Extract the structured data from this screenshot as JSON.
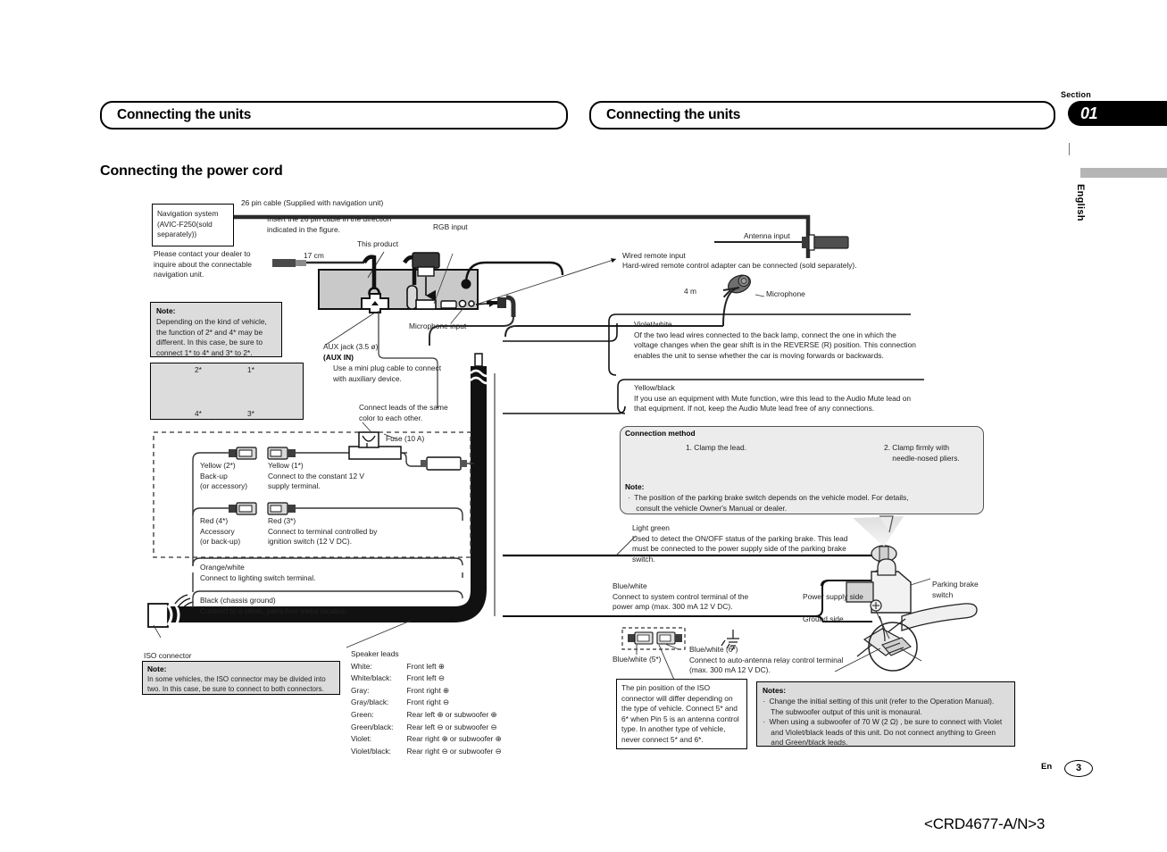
{
  "header": {
    "left_title": "Connecting the units",
    "right_title": "Connecting the units",
    "section_label": "Section",
    "section_number": "01",
    "language": "English"
  },
  "page_title": "Connecting the power cord",
  "diagram": {
    "nav_box": "Navigation system\n(AVIC-F250(sold\nseparately))",
    "nav_dealer_note": "Please contact your dealer to\ninquire about the connectable\nnavigation unit.",
    "cable_26pin": "26 pin cable (Supplied with navigation unit)",
    "insert_note": "Insert the 26 pin cable in the direction\nindicated in the figure.",
    "this_product": "This product",
    "rgb_input": "RGB input",
    "length_17cm": "17 cm",
    "microphone_input": "Microphone input",
    "antenna_input": "Antenna input",
    "wired_remote_title": "Wired remote input",
    "wired_remote_body": "Hard-wired remote control adapter can be connected (sold separately).",
    "mic_length": "4 m",
    "microphone": "Microphone",
    "note1_title": "Note:",
    "note1_body": "Depending on the kind of vehicle,\nthe function of 2* and 4* may be\ndifferent. In this case, be sure to\nconnect 1* to 4* and 3* to 2*.",
    "swap_labels": {
      "tl": "2*",
      "tr": "1*",
      "bl": "4*",
      "br": "3*"
    },
    "aux_jack_line1": "AUX jack (3.5 ø)",
    "aux_jack_line2": "(AUX IN)",
    "aux_jack_line3": "Use a mini plug cable to connect\nwith auxiliary device.",
    "same_color": "Connect leads of the same\ncolor to each other.",
    "fuse": "Fuse (10 A)",
    "yellow2_label": "Yellow (2*)\nBack-up\n(or accessory)",
    "yellow1_label": "Yellow (1*)\nConnect to the constant 12 V\nsupply terminal.",
    "red4_label": "Red (4*)\nAccessory\n(or back-up)",
    "red3_label": "Red (3*)\nConnect to terminal controlled by\nignition switch (12 V DC).",
    "orange_white": "Orange/white\nConnect to lighting switch terminal.",
    "black_ground": "Black (chassis ground)\nConnect to a clean, paint-free metal location.",
    "iso_connector": "ISO connector",
    "iso_note_title": "Note:",
    "iso_note_body": "In some vehicles, the ISO connector may be divided into\ntwo. In this case, be sure to connect to both connectors.",
    "violet_white": "Violet/white\nOf the two lead wires connected to the back lamp, connect the one in which the\nvoltage changes when the gear shift is in the REVERSE (R) position. This connection\nenables the unit to sense whether the car is moving forwards or backwards.",
    "yellow_black": "Yellow/black\nIf you use an equipment with Mute function, wire this lead to the Audio Mute lead on\nthat equipment. If not, keep the Audio Mute lead free of any connections.",
    "connection_method_title": "Connection method",
    "connection_step1": "1. Clamp the lead.",
    "connection_step2": "2. Clamp firmly with\n    needle-nosed pliers.",
    "connection_note_title": "Note:",
    "connection_note_body": "·  The position of the parking brake switch depends on the vehicle model. For details,\n    consult the vehicle Owner's Manual or dealer.",
    "light_green": "Light green\nUsed to detect the ON/OFF status of the parking brake. This lead\nmust be connected to the power supply side of the parking brake\nswitch.",
    "blue_white": "Blue/white\nConnect to system control terminal of the\npower amp (max. 300 mA 12 V DC).",
    "power_supply_side": "Power supply side",
    "ground_side": "Ground side",
    "parking_brake_switch": "Parking brake\nswitch",
    "blue_white_5": "Blue/white (5*)",
    "blue_white_6": "Blue/white (6*)\nConnect to auto-antenna relay control terminal\n(max. 300 mA 12 V DC).",
    "iso_pin_note": "The pin position of the ISO\nconnector will differ depending on\nthe type of vehicle. Connect 5* and\n6* when Pin 5 is an antenna control\ntype. In another type of vehicle,\nnever connect 5* and 6*.",
    "notes_title": "Notes:",
    "notes_body": "·  Change the initial setting of this unit (refer to the Operation Manual).\n    The subwoofer output of this unit is monaural.\n·  When using a subwoofer of 70 W (2 Ω) , be sure to connect with Violet\n    and Violet/black leads of this unit. Do not connect anything to Green\n    and Green/black leads.",
    "speaker_leads_title": "Speaker leads",
    "speaker_leads": [
      {
        "color": "White:",
        "assign": "Front left ⊕"
      },
      {
        "color": "White/black:",
        "assign": "Front left ⊖"
      },
      {
        "color": "Gray:",
        "assign": "Front right ⊕"
      },
      {
        "color": "Gray/black:",
        "assign": "Front right ⊖"
      },
      {
        "color": "Green:",
        "assign": "Rear left ⊕ or subwoofer ⊕"
      },
      {
        "color": "Green/black:",
        "assign": "Rear left ⊖ or subwoofer ⊖"
      },
      {
        "color": "Violet:",
        "assign": "Rear right ⊕ or subwoofer ⊕"
      },
      {
        "color": "Violet/black:",
        "assign": "Rear right ⊖ or subwoofer ⊖"
      }
    ]
  },
  "footer": {
    "lang_code": "En",
    "page_number": "3",
    "doc_code": "<CRD4677-A/N>3"
  }
}
